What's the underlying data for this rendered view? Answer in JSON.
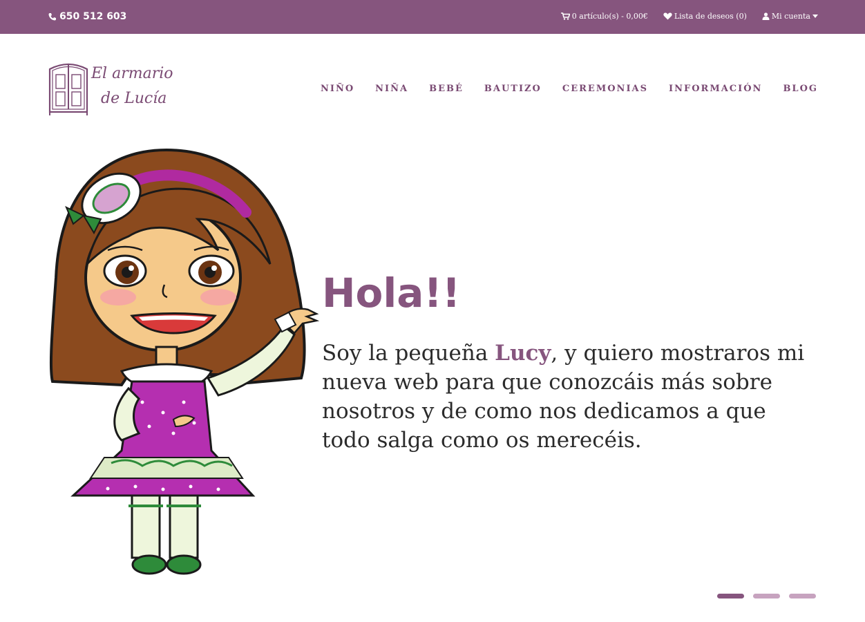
{
  "topbar": {
    "phone": "650 512 603",
    "cart": "0 artículo(s) - 0,00€",
    "wishlist": "Lista de deseos (0)",
    "account": "Mi cuenta"
  },
  "logo": {
    "line1": "El armario",
    "line2": "de Lucía"
  },
  "nav": [
    "NIÑO",
    "NIÑA",
    "BEBÉ",
    "BAUTIZO",
    "CEREMONIAS",
    "INFORMACIÓN",
    "BLOG"
  ],
  "hero": {
    "title": "Hola!!",
    "text_before": "Soy la pequeña ",
    "highlight": "Lucy",
    "text_after": ", y quiero mostraros mi nueva web para que conozcáis más sobre nosotros y de como nos dedicamos a que todo salga como os merecéis."
  },
  "slider": {
    "count": 3,
    "active_index": 0
  },
  "colors": {
    "brand": "#86557e",
    "brand_light": "#c7a3bf"
  }
}
